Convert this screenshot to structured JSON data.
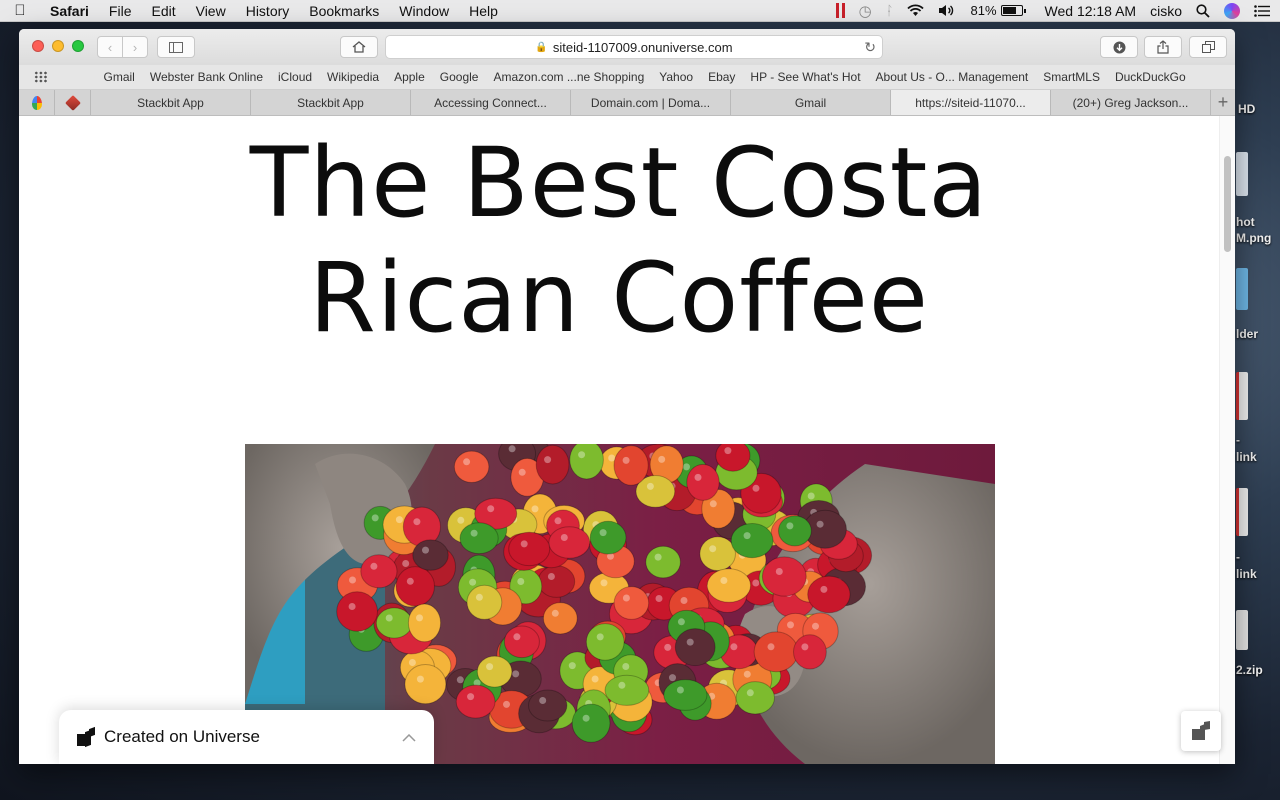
{
  "menubar": {
    "app_name": "Safari",
    "items": [
      "File",
      "Edit",
      "View",
      "History",
      "Bookmarks",
      "Window",
      "Help"
    ],
    "battery_percent": "81%",
    "battery_level": 0.81,
    "datetime": "Wed 12:18 AM",
    "user": "cisko"
  },
  "desktop": {
    "labels": [
      "HD",
      "hot",
      "M.png",
      "lder",
      "-",
      "link",
      "-",
      "link",
      "2.zip"
    ]
  },
  "browser": {
    "url": "siteid-1107009.onuniverse.com",
    "favorites": [
      "Gmail",
      "Webster Bank Online",
      "iCloud",
      "Wikipedia",
      "Apple",
      "Google",
      "Amazon.com ...ne Shopping",
      "Yahoo",
      "Ebay",
      "HP - See What's Hot",
      "About Us - O... Management",
      "SmartMLS",
      "DuckDuckGo"
    ],
    "tabs": [
      "Stackbit App",
      "Stackbit App",
      "Accessing Connect...",
      "Domain.com | Doma...",
      "Gmail",
      "https://siteid-11070...",
      "(20+) Greg Jackson..."
    ],
    "active_tab_index": 5
  },
  "page": {
    "title_line1": "The Best Costa",
    "title_line2": "Rican Coffee",
    "badge_text": "Created on Universe"
  },
  "colors": {
    "close": "#fc5f57",
    "minimize": "#fdbc2e",
    "maximize": "#27c840",
    "recording_indicator": "#c8202a"
  }
}
